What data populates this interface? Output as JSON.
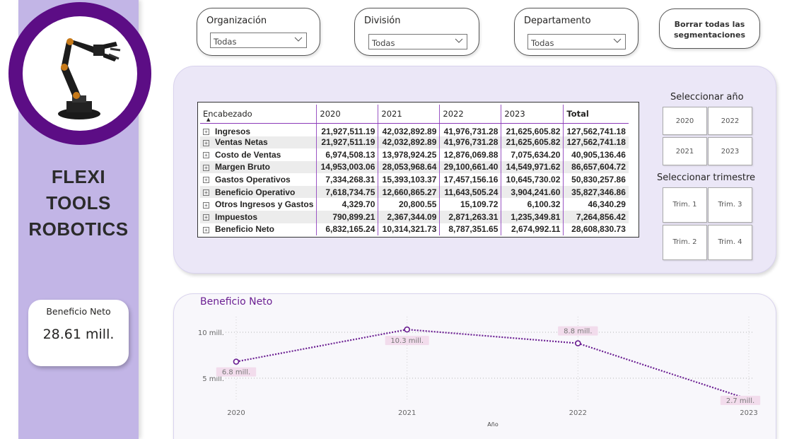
{
  "brand": {
    "line1": "FLEXI",
    "line2": "TOOLS",
    "line3": "ROBOTICS",
    "logo_icon": "robot-arm-icon"
  },
  "kpi": {
    "label": "Beneficio Neto",
    "value": "28.61 mill."
  },
  "filters": {
    "organizacion": {
      "title": "Organización",
      "value": "Todas"
    },
    "division": {
      "title": "División",
      "value": "Todas"
    },
    "departamento": {
      "title": "Departamento",
      "value": "Todas"
    },
    "clear_label_1": "Borrar todas las",
    "clear_label_2": "segmentaciones"
  },
  "matrix": {
    "columns": [
      "Encabezado",
      "2020",
      "2021",
      "2022",
      "2023",
      "Total"
    ],
    "rows": [
      [
        "Ingresos",
        "21,927,511.19",
        "42,032,892.89",
        "41,976,731.28",
        "21,625,605.82",
        "127,562,741.18"
      ],
      [
        "Ventas Netas",
        "21,927,511.19",
        "42,032,892.89",
        "41,976,731.28",
        "21,625,605.82",
        "127,562,741.18"
      ],
      [
        "Costo de Ventas",
        "6,974,508.13",
        "13,978,924.25",
        "12,876,069.88",
        "7,075,634.20",
        "40,905,136.46"
      ],
      [
        "Margen Bruto",
        "14,953,003.06",
        "28,053,968.64",
        "29,100,661.40",
        "14,549,971.62",
        "86,657,604.72"
      ],
      [
        "Gastos Operativos",
        "7,334,268.31",
        "15,393,103.37",
        "17,457,156.16",
        "10,645,730.02",
        "50,830,257.86"
      ],
      [
        "Beneficio Operativo",
        "7,618,734.75",
        "12,660,865.27",
        "11,643,505.24",
        "3,904,241.60",
        "35,827,346.86"
      ],
      [
        "Otros Ingresos y Gastos",
        "4,329.70",
        "20,800.55",
        "15,109.72",
        "6,100.32",
        "46,340.29"
      ],
      [
        "Impuestos",
        "790,899.21",
        "2,367,344.09",
        "2,871,263.31",
        "1,235,349.81",
        "7,264,856.42"
      ],
      [
        "Beneficio Neto",
        "6,832,165.24",
        "10,314,321.73",
        "8,787,351.65",
        "2,674,992.11",
        "28,608,830.73"
      ]
    ]
  },
  "year_selector": {
    "title": "Seleccionar año",
    "options": [
      "2020",
      "2022",
      "2021",
      "2023"
    ]
  },
  "quarter_selector": {
    "title": "Seleccionar trimestre",
    "options": [
      "Trim. 1",
      "Trim. 3",
      "Trim. 2",
      "Trim. 4"
    ]
  },
  "chart_data": {
    "type": "line",
    "title": "Beneficio Neto",
    "xlabel": "Año",
    "ylabel": "",
    "x": [
      "2020",
      "2021",
      "2022",
      "2023"
    ],
    "values": [
      6.8,
      10.3,
      8.8,
      2.7
    ],
    "data_labels": [
      "6.8 mill.",
      "10.3 mill.",
      "8.8 mill.",
      "2.7 mill."
    ],
    "y_ticks": [
      {
        "value": 5,
        "label": "5 mill."
      },
      {
        "value": 10,
        "label": "10 mill."
      }
    ],
    "ylim": [
      2.7,
      10.3
    ],
    "grid": true,
    "line_color": "#6b1f92"
  }
}
